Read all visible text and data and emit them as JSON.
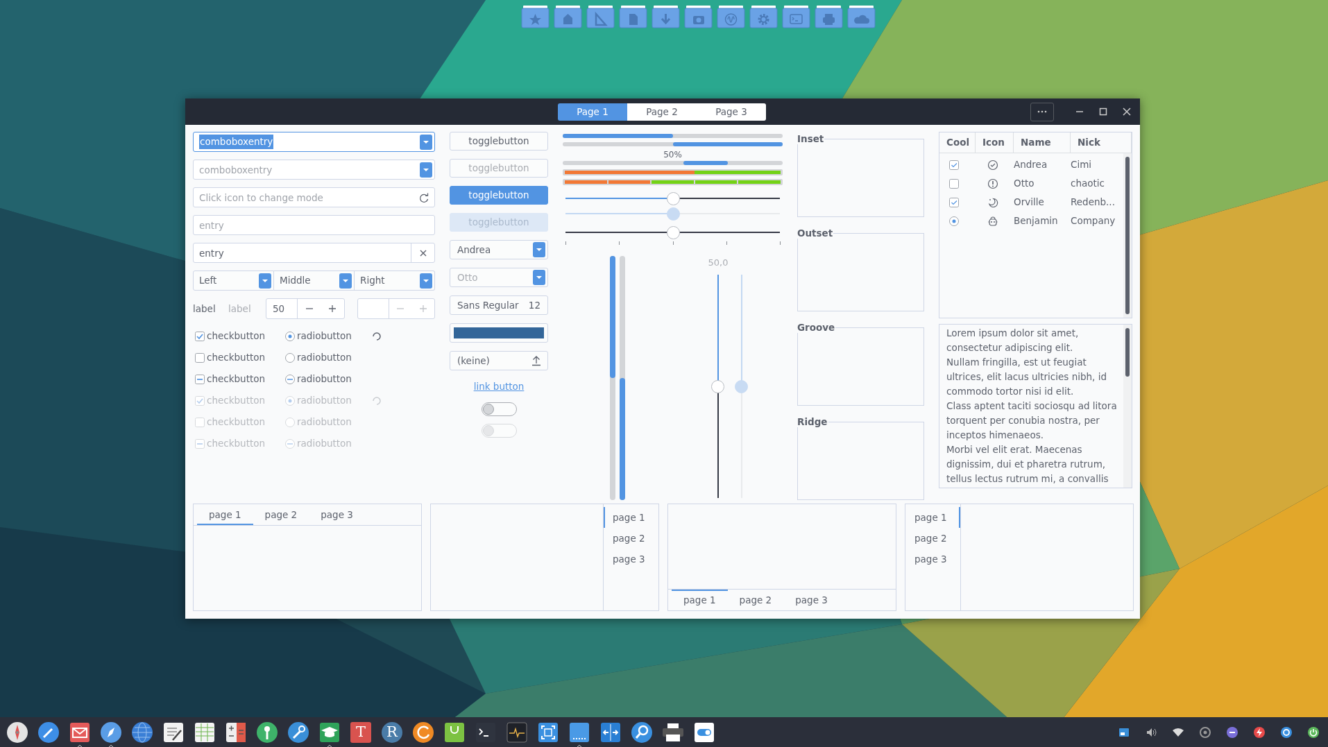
{
  "dock": {
    "items": [
      {
        "kind": "star"
      },
      {
        "kind": "home"
      },
      {
        "kind": "triangle"
      },
      {
        "kind": "document"
      },
      {
        "kind": "download"
      },
      {
        "kind": "camera"
      },
      {
        "kind": "wave"
      },
      {
        "kind": "gear"
      },
      {
        "kind": "terminal"
      },
      {
        "kind": "printer"
      },
      {
        "kind": "cloud"
      }
    ]
  },
  "window": {
    "tabs": [
      {
        "label": "Page 1",
        "selected": true
      },
      {
        "label": "Page 2",
        "selected": false
      },
      {
        "label": "Page 3",
        "selected": false
      }
    ]
  },
  "entries": {
    "combo_entries": [
      {
        "value": "comboboxentry",
        "text_selected": true
      },
      {
        "placeholder": "comboboxentry",
        "text_selected": false
      }
    ],
    "mode_entry": {
      "placeholder": "Click icon to change mode"
    },
    "plain_entry": {
      "placeholder": "entry"
    },
    "clear_entry": {
      "value": "entry"
    },
    "combos": [
      {
        "value": "Left"
      },
      {
        "value": "Middle"
      },
      {
        "value": "Right"
      }
    ],
    "labels": [
      {
        "text": "label",
        "disabled": false
      },
      {
        "text": "label",
        "disabled": true
      }
    ],
    "spinbuttons": [
      {
        "value": "50",
        "disabled": false
      },
      {
        "disabled": true
      }
    ]
  },
  "toggle_rows": [
    {
      "check": {
        "label": "checkbutton",
        "checked": true,
        "inconsistent": false
      },
      "radio": {
        "label": "radiobutton",
        "checked": true,
        "inconsistent": false
      },
      "spinner": true,
      "disabled": false
    },
    {
      "check": {
        "label": "checkbutton",
        "checked": false,
        "inconsistent": false
      },
      "radio": {
        "label": "radiobutton",
        "checked": false,
        "inconsistent": false
      },
      "spinner": false,
      "disabled": false
    },
    {
      "check": {
        "label": "checkbutton",
        "checked": false,
        "inconsistent": true
      },
      "radio": {
        "label": "radiobutton",
        "checked": false,
        "inconsistent": true
      },
      "spinner": false,
      "disabled": false
    },
    {
      "check": {
        "label": "checkbutton",
        "checked": true,
        "inconsistent": false
      },
      "radio": {
        "label": "radiobutton",
        "checked": true,
        "inconsistent": false
      },
      "spinner": true,
      "disabled": true
    },
    {
      "check": {
        "label": "checkbutton",
        "checked": false,
        "inconsistent": false
      },
      "radio": {
        "label": "radiobutton",
        "checked": false,
        "inconsistent": false
      },
      "spinner": false,
      "disabled": true
    },
    {
      "check": {
        "label": "checkbutton",
        "checked": false,
        "inconsistent": true
      },
      "radio": {
        "label": "radiobutton",
        "checked": false,
        "inconsistent": true
      },
      "spinner": false,
      "disabled": true
    }
  ],
  "buttons": {
    "togglebuttons": [
      {
        "label": "togglebutton",
        "active": false,
        "disabled": false
      },
      {
        "label": "togglebutton",
        "active": false,
        "disabled": true
      },
      {
        "label": "togglebutton",
        "active": true,
        "disabled": false
      },
      {
        "label": "togglebutton",
        "active": true,
        "disabled": true
      }
    ],
    "combos": [
      {
        "value": "Andrea",
        "disabled": false
      },
      {
        "value": "Otto",
        "disabled": true
      }
    ],
    "font_button": {
      "family": "Sans Regular",
      "size": "12"
    },
    "color_button": {
      "color": "#336699"
    },
    "file_button": {
      "value": "(keine)"
    },
    "link_button": {
      "label": "link button"
    },
    "switches": [
      {
        "on": false,
        "disabled": false
      },
      {
        "on": false,
        "disabled": true
      }
    ]
  },
  "scales": {
    "progress": [
      {
        "level": 0.5,
        "inverted": false
      },
      {
        "level": 0.5,
        "inverted": true
      }
    ],
    "pulse": {
      "label": "50%"
    },
    "level_bars": [
      {
        "kind": "continuous",
        "blocks": [
          {
            "color": "#f27835"
          },
          {
            "color": "#f27835"
          },
          {
            "color": "#f27835"
          },
          {
            "color": "#73d216"
          },
          {
            "color": "#73d216"
          }
        ]
      },
      {
        "kind": "discrete",
        "blocks": [
          {
            "color": "#f27835"
          },
          {
            "color": "#f27835"
          },
          {
            "color": "#73d216"
          },
          {
            "color": "#73d216"
          },
          {
            "color": "#73d216"
          }
        ]
      }
    ],
    "hscales": [
      {
        "level": 0.5,
        "disabled": false,
        "marks": false
      },
      {
        "level": 0.5,
        "disabled": true,
        "marks": false
      },
      {
        "level": 0.5,
        "disabled": false,
        "marks": true
      }
    ],
    "vprogress": [
      {
        "level": 0.5,
        "inverted": false
      },
      {
        "level": 0.5,
        "inverted": true
      }
    ],
    "vscales": [
      {
        "level": 0.5,
        "disabled": false,
        "value": "50,0"
      },
      {
        "level": 0.5,
        "disabled": true
      }
    ]
  },
  "frames": [
    {
      "label": "Inset"
    },
    {
      "label": "Outset"
    },
    {
      "label": "Groove"
    },
    {
      "label": "Ridge"
    }
  ],
  "tree": {
    "columns": [
      "Cool",
      "Icon",
      "Name",
      "Nick"
    ],
    "rows": [
      {
        "kind": "check",
        "checked": true,
        "name": "Andrea",
        "nick": "Cimi"
      },
      {
        "kind": "check",
        "checked": false,
        "name": "Otto",
        "nick": "chaotic"
      },
      {
        "kind": "check",
        "checked": true,
        "name": "Orville",
        "nick": "Redenb..."
      },
      {
        "kind": "radio",
        "checked": true,
        "name": "Benjamin",
        "nick": "Company"
      }
    ]
  },
  "text_view": {
    "paragraphs": [
      "Lorem ipsum dolor sit amet, consectetur adipiscing elit.",
      "Nullam fringilla, est ut feugiat ultrices, elit lacus ultricies nibh, id commodo tortor nisi id elit.",
      "Class aptent taciti sociosqu ad litora torquent per conubia nostra, per inceptos himenaeos.",
      "Morbi vel elit erat. Maecenas dignissim, dui et pharetra rutrum, tellus lectus rutrum mi, a convallis"
    ]
  },
  "notebooks": [
    {
      "kind": "top",
      "tabs": [
        {
          "label": "page 1",
          "selected": true
        },
        {
          "label": "page 2",
          "selected": false
        },
        {
          "label": "page 3",
          "selected": false
        }
      ]
    },
    {
      "kind": "right",
      "tabs": [
        {
          "label": "page 1",
          "selected": true
        },
        {
          "label": "page 2",
          "selected": false
        },
        {
          "label": "page 3",
          "selected": false
        }
      ]
    },
    {
      "kind": "bottom",
      "tabs": [
        {
          "label": "page 1",
          "selected": true
        },
        {
          "label": "page 2",
          "selected": false
        },
        {
          "label": "page 3",
          "selected": false
        }
      ]
    },
    {
      "kind": "left",
      "tabs": [
        {
          "label": "page 1",
          "selected": true
        },
        {
          "label": "page 2",
          "selected": false
        },
        {
          "label": "page 3",
          "selected": false
        }
      ]
    }
  ],
  "taskbar": {
    "apps": [
      {
        "kind": "compass",
        "running": false
      },
      {
        "kind": "pen",
        "running": false
      },
      {
        "kind": "mail",
        "running": true
      },
      {
        "kind": "compass-blue",
        "running": true
      },
      {
        "kind": "globe",
        "running": false
      },
      {
        "kind": "editor",
        "running": false
      },
      {
        "kind": "spreadsheet",
        "running": false
      },
      {
        "kind": "calculator",
        "running": false
      },
      {
        "kind": "key",
        "running": false
      },
      {
        "kind": "wrench",
        "running": false
      },
      {
        "kind": "cap",
        "running": true
      },
      {
        "kind": "letter",
        "text": "T",
        "running": false
      },
      {
        "kind": "letter-round",
        "text": "R",
        "running": false
      },
      {
        "kind": "refresh",
        "running": false
      },
      {
        "kind": "bag",
        "running": false
      },
      {
        "kind": "terminal",
        "running": false
      },
      {
        "kind": "monitor",
        "running": false
      },
      {
        "kind": "screenshot",
        "running": false
      },
      {
        "kind": "display",
        "running": true
      },
      {
        "kind": "arrows",
        "running": false
      },
      {
        "kind": "search",
        "running": false
      },
      {
        "kind": "printer",
        "running": false
      },
      {
        "kind": "toggle",
        "running": false
      }
    ],
    "tray": [
      {
        "kind": "box"
      },
      {
        "kind": "speaker"
      },
      {
        "kind": "wifi"
      },
      {
        "kind": "disc"
      },
      {
        "kind": "minus"
      },
      {
        "kind": "bolt"
      },
      {
        "kind": "sync"
      },
      {
        "kind": "power"
      }
    ]
  }
}
